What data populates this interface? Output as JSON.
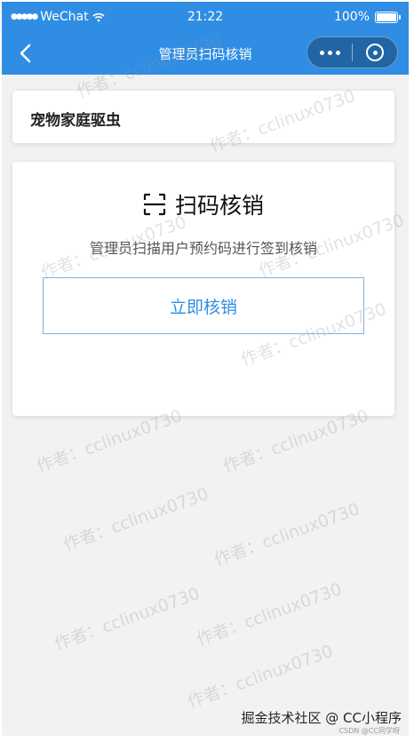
{
  "status_bar": {
    "carrier": "WeChat",
    "time": "21:22",
    "battery": "100%"
  },
  "nav": {
    "title": "管理员扫码核销"
  },
  "header_card": {
    "title": "宠物家庭驱虫"
  },
  "scan_card": {
    "heading": "扫码核销",
    "subtitle": "管理员扫描用户预约码进行签到核销",
    "button_label": "立即核销"
  },
  "watermark": "作者：cclinux0730",
  "footer": {
    "brand": "掘金技术社区 @ CC小程序",
    "csdn": "CSDN @CC同学呀"
  },
  "colors": {
    "primary": "#2f8de4",
    "background": "#f2f2f2"
  },
  "icons": [
    "signal-dots-icon",
    "wifi-icon",
    "battery-icon",
    "back-arrow-icon",
    "more-dots-icon",
    "close-circle-icon",
    "scan-icon"
  ]
}
